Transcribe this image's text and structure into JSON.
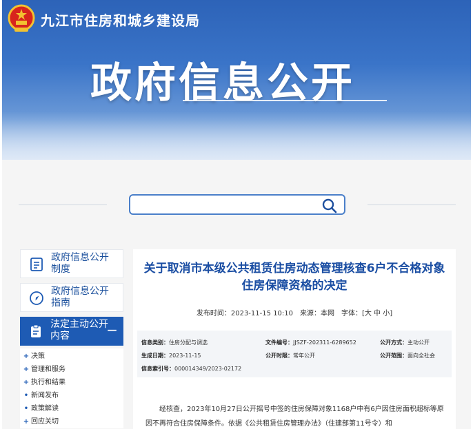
{
  "header": {
    "site_name": "九江市住房和城乡建设局",
    "banner_title": "政府信息公开"
  },
  "search": {
    "placeholder": ""
  },
  "sidebar": {
    "items": [
      {
        "label": "政府信息公开制度",
        "icon": "document-list-icon"
      },
      {
        "label": "政府信息公开指南",
        "icon": "compass-icon"
      },
      {
        "label": "法定主动公开内容",
        "icon": "clipboard-icon",
        "toggle": "−"
      }
    ],
    "sub_items": [
      {
        "marker": "+",
        "label": "决策"
      },
      {
        "marker": "+",
        "label": "管理和服务"
      },
      {
        "marker": "+",
        "label": "执行和结果"
      },
      {
        "marker": "•",
        "label": "新闻发布"
      },
      {
        "marker": "•",
        "label": "政策解读"
      },
      {
        "marker": "+",
        "label": "回应关切"
      }
    ]
  },
  "article": {
    "title": "关于取消市本级公共租赁住房动态管理核查6户不合格对象住房保障资格的决定",
    "meta": "发布时间：2023-11-15 10:10　来源：本网　字体：[大 中 小]",
    "info": {
      "category_label": "信息类别：",
      "category_value": "住房分配与调选",
      "doc_no_label": "文件编号：",
      "doc_no_value": "JJSZF-202311-6289652",
      "publish_mode_label": "公开方式：",
      "publish_mode_value": "主动公开",
      "date_label": "生成日期：",
      "date_value": "2023-11-15",
      "period_label": "公开时限：",
      "period_value": "常年公开",
      "scope_label": "公开范围：",
      "scope_value": "面向全社会",
      "index_label": "信息索引号：",
      "index_value": "000014349/2023-02172"
    },
    "body": "经核查，2023年10月27日公开摇号中签的住房保障对象1168户中有6户因住房面积超标等原因不再符合住房保障条件。依据《公共租赁住房管理办法》（住建部第11号令）和"
  },
  "colors": {
    "primary": "#1e5bb4",
    "title_blue": "#1b4ea3",
    "banner_blue": "#2d63b8"
  }
}
